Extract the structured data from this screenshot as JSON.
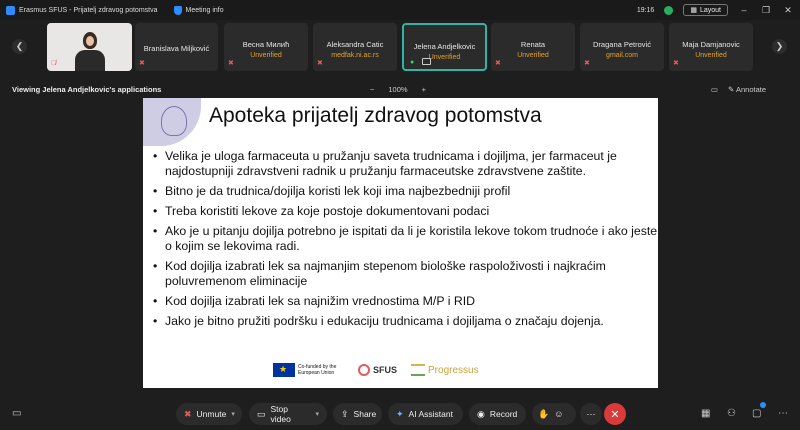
{
  "window": {
    "title": "Erasmus SFUS - Prijatelj zdravog potomstva",
    "meeting_info": "Meeting info",
    "time": "19:16",
    "layout_label": "Layout",
    "minimize": "–",
    "restore": "❐",
    "close": "✕"
  },
  "participants": [
    {
      "name": "Branislava Miljković",
      "sub": ""
    },
    {
      "name": "Весна Милић",
      "sub": "Unverified"
    },
    {
      "name": "Aleksandra Catic",
      "sub": "medfak.ni.ac.rs"
    },
    {
      "name": "Jelena Andjelkovic",
      "sub": "Unverified",
      "active": true
    },
    {
      "name": "Renata",
      "sub": "Unverified"
    },
    {
      "name": "Dragana Petrović",
      "sub": "gmail.com"
    },
    {
      "name": "Maja Damjanovic",
      "sub": "Unverified"
    }
  ],
  "viewbar": {
    "viewing": "Viewing Jelena Andjelkovic's applications",
    "zoom_out": "−",
    "zoom": "100%",
    "zoom_in": "+",
    "annotate": "Annotate"
  },
  "slide": {
    "title": "Apoteka prijatelj zdravog potomstva",
    "bullets": [
      "Velika je uloga farmaceuta u pružanju saveta trudnicama i dojiljma, jer farmaceut je najdostupniji zdravstveni radnik u pružanju farmaceutske zdravstvene zaštite.",
      "Bitno je da trudnica/dojilja koristi lek koji ima najbezbedniji profil",
      "Treba koristiti lekove za koje postoje dokumentovani podaci",
      "Ako je u pitanju dojilja potrebno je ispitati da li je koristila lekove tokom trudnoće i ako jeste o kojim se lekovima radi.",
      "Kod dojilja izabrati lek sa najmanjim stepenom biološke raspoloživosti i najkraćim poluvremenom eliminacije",
      "Kod dojilja izabrati lek sa najnižim vrednostima M/P i RID",
      "Jako je bitno pružiti podršku i edukaciju trudnicama i dojiljama o značaju dojenja."
    ],
    "logos": {
      "eu": "Co-funded by the European Union",
      "sfus": "SFUS",
      "progressus": "Progressus"
    }
  },
  "toolbar": {
    "unmute": "Unmute",
    "stop_video": "Stop video",
    "share": "Share",
    "ai_assistant": "AI Assistant",
    "record": "Record"
  }
}
